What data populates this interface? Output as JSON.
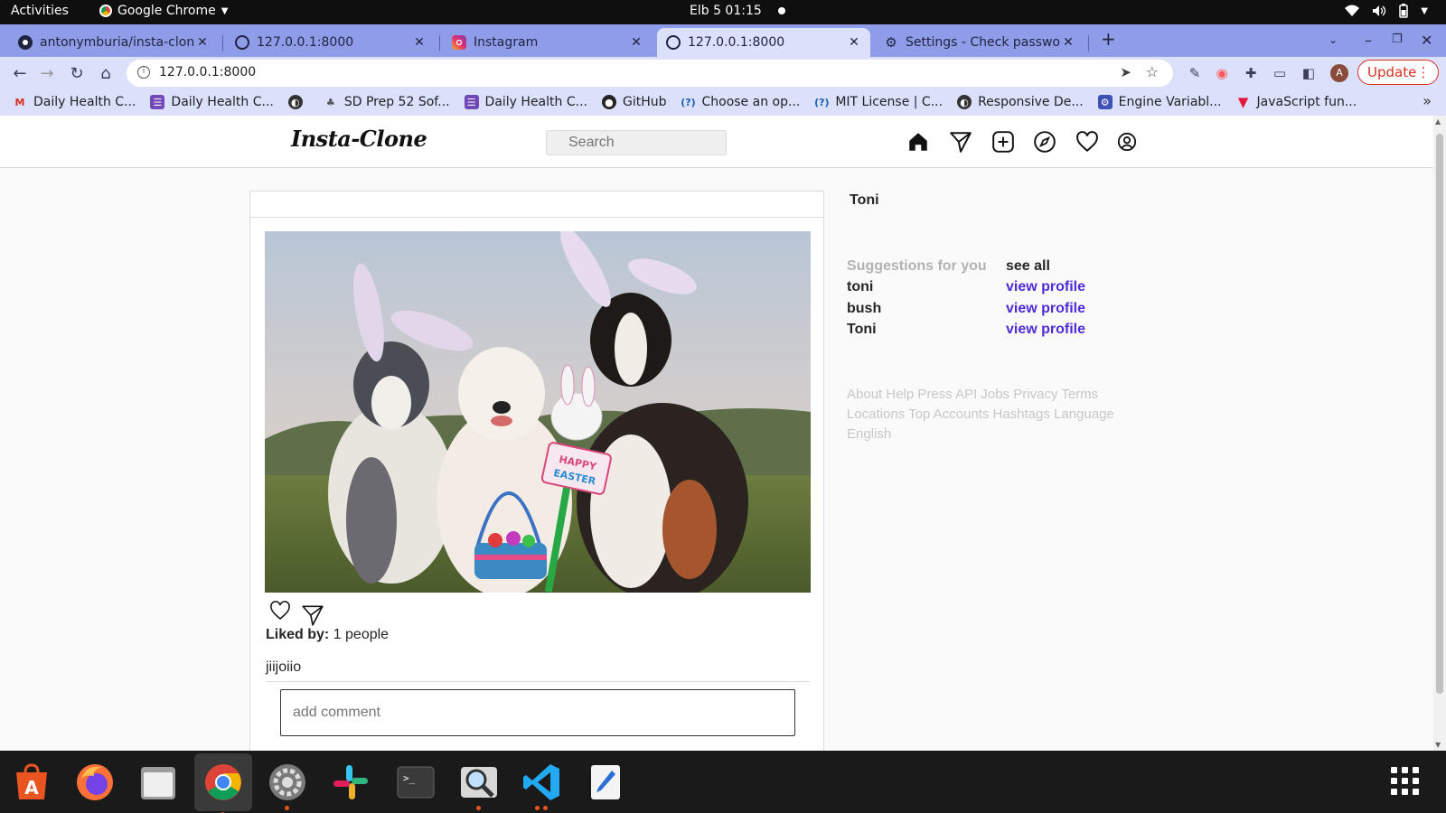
{
  "system": {
    "activities": "Activities",
    "app_name": "Google Chrome",
    "clock": "Elb 5  01:15"
  },
  "tabs": [
    {
      "title": "antonymburia/insta-clone",
      "icon": "github-icon"
    },
    {
      "title": "127.0.0.1:8000",
      "icon": "globe-icon"
    },
    {
      "title": "Instagram",
      "icon": "instagram-icon"
    },
    {
      "title": "127.0.0.1:8000",
      "icon": "globe-icon",
      "active": true
    },
    {
      "title": "Settings - Check passwords",
      "icon": "gear-icon"
    }
  ],
  "toolbar": {
    "url": "127.0.0.1:8000",
    "profile_initial": "A",
    "update_label": "Update"
  },
  "bookmarks": [
    {
      "label": "Daily Health C...",
      "icon": "gmail-icon"
    },
    {
      "label": "Daily Health C...",
      "icon": "form-icon"
    },
    {
      "label": "",
      "icon": "globe-icon"
    },
    {
      "label": "SD Prep 52 Sof...",
      "icon": "tree-icon"
    },
    {
      "label": "Daily Health C...",
      "icon": "form-icon"
    },
    {
      "label": "GitHub",
      "icon": "github-icon"
    },
    {
      "label": "Choose an op...",
      "icon": "question-icon"
    },
    {
      "label": "MIT License | C...",
      "icon": "question-icon"
    },
    {
      "label": "Responsive De...",
      "icon": "globe-icon"
    },
    {
      "label": "Engine Variabl...",
      "icon": "engine-icon"
    },
    {
      "label": "JavaScript fun...",
      "icon": "tesla-icon"
    }
  ],
  "page": {
    "logo": "Insta-Clone",
    "search_placeholder": "Search",
    "post": {
      "liked_by_label": "Liked by:",
      "liked_by_value": "1 people",
      "caption": "jiijoiio",
      "comment_placeholder": "add comment"
    },
    "sidebar": {
      "username": "Toni",
      "suggestions_title": "Suggestions for you",
      "see_all": "see all",
      "suggestions": [
        {
          "name": "toni",
          "action": "view profile"
        },
        {
          "name": "bush",
          "action": "view profile"
        },
        {
          "name": "Toni",
          "action": "view profile"
        }
      ],
      "footer_line1": "About Help Press API Jobs Privacy Terms",
      "footer_line2": "Locations Top Accounts Hashtags Language",
      "footer_line3": "English"
    }
  },
  "colors": {
    "tab_strip": "#8f9de8",
    "toolbar": "#dbe0fb",
    "link": "#4f2cd8",
    "update_red": "#d93025"
  }
}
